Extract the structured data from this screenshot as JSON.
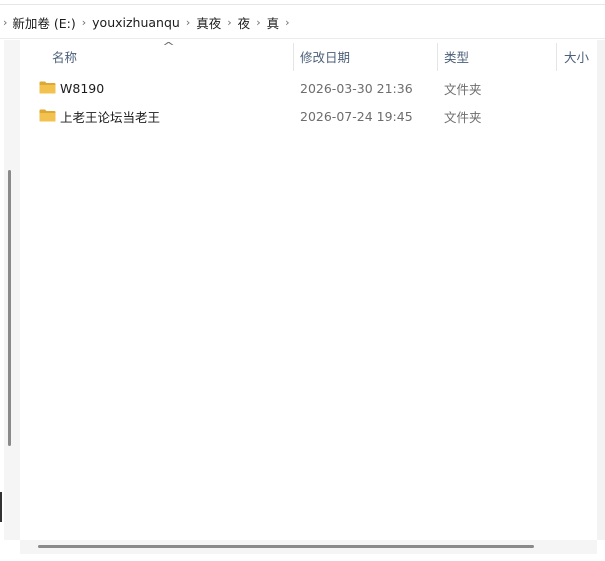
{
  "breadcrumb": {
    "items": [
      {
        "label": "新加卷 (E:)"
      },
      {
        "label": "youxizhuanqu"
      },
      {
        "label": "真夜"
      },
      {
        "label": "夜"
      },
      {
        "label": "真"
      }
    ]
  },
  "columns": {
    "name": "名称",
    "date_modified": "修改日期",
    "type": "类型",
    "size": "大小",
    "sort_indicator": "^"
  },
  "files": [
    {
      "name": "W8190",
      "date_modified": "2026-03-30 21:36",
      "type": "文件夹",
      "icon": "folder-icon"
    },
    {
      "name": "上老王论坛当老王",
      "date_modified": "2026-07-24 19:45",
      "type": "文件夹",
      "icon": "folder-icon"
    }
  ],
  "colors": {
    "folder": "#f2c14e",
    "folder_dark": "#dca935",
    "header_text": "#4c607a",
    "secondary_text": "#6d6d6d"
  }
}
